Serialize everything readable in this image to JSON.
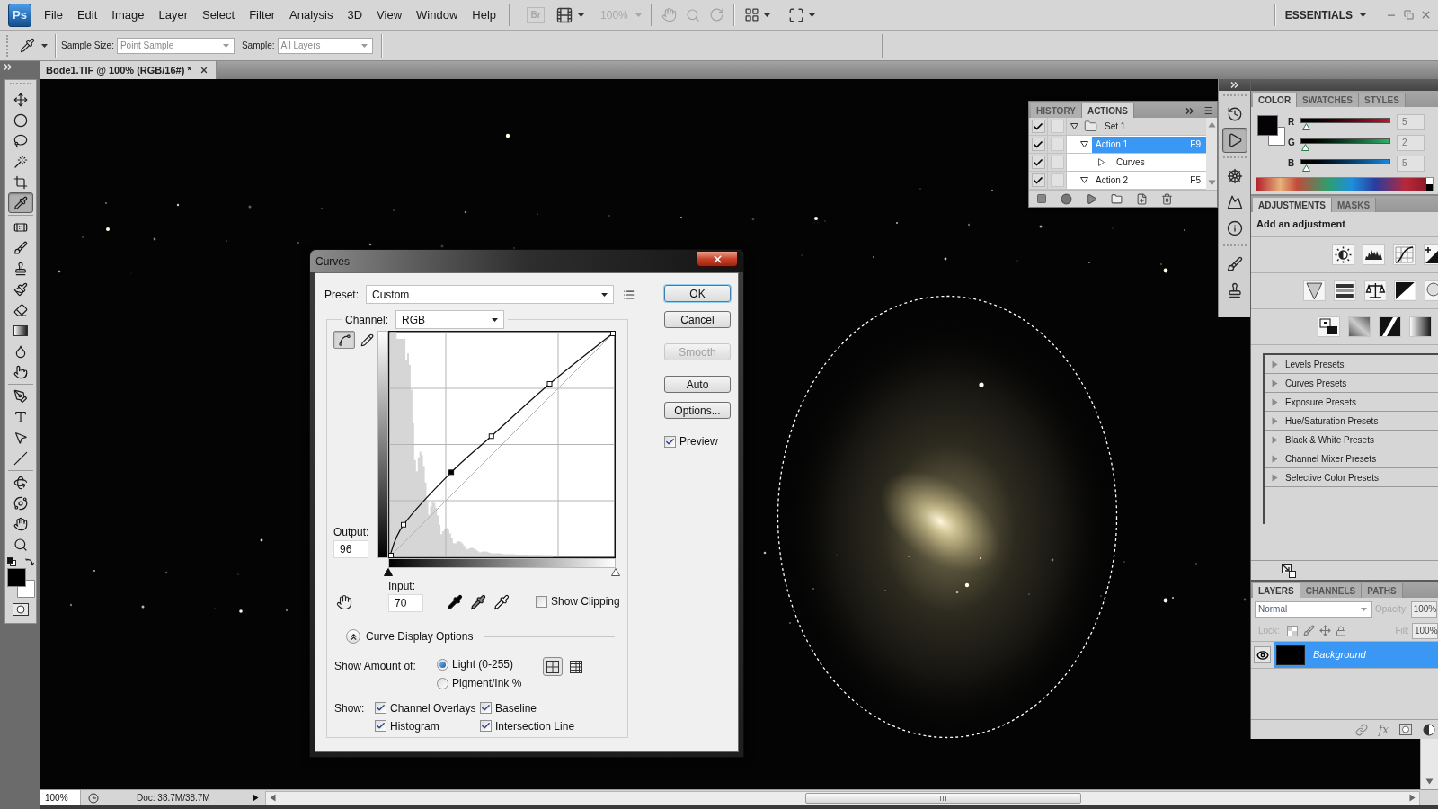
{
  "menu_bar": {
    "logo": "Ps",
    "items": [
      "File",
      "Edit",
      "Image",
      "Layer",
      "Select",
      "Filter",
      "Analysis",
      "3D",
      "View",
      "Window",
      "Help"
    ],
    "bridge": "Br",
    "zoom": {
      "value": "100%",
      "disabled": true
    },
    "workspace": "ESSENTIALS"
  },
  "options_bar": {
    "sample_size": {
      "label": "Sample Size:",
      "value": "Point Sample"
    },
    "sample": {
      "label": "Sample:",
      "value": "All Layers"
    }
  },
  "tools": [
    {
      "selected": false
    },
    {
      "selected": false
    },
    {
      "selected": false
    },
    {
      "selected": false
    },
    {
      "selected": false
    },
    {
      "selected": true
    },
    {
      "selected": false
    },
    {
      "selected": false
    },
    {
      "selected": false
    },
    {
      "selected": false
    },
    {
      "selected": false
    },
    {
      "selected": false
    },
    {
      "selected": false
    },
    {
      "selected": false
    },
    {
      "selected": false
    },
    {
      "selected": false
    },
    {
      "selected": false
    },
    {
      "selected": false
    },
    {
      "selected": false
    },
    {
      "selected": false
    },
    {
      "selected": false
    },
    {
      "selected": false
    }
  ],
  "document": {
    "tab": "Bode1.TIF @ 100% (RGB/16#) *",
    "status": {
      "zoom": "100%",
      "doc": "Doc: 38.7M/38.7M"
    }
  },
  "actions_panel": {
    "tabs": [
      {
        "label": "HISTORY",
        "selected": false
      },
      {
        "label": "ACTIONS",
        "selected": true
      }
    ],
    "items": [
      {
        "label": "Set 1",
        "kind": "set",
        "checked": true,
        "dialog": false,
        "expanded": true,
        "selected": false,
        "children": [
          {
            "label": "Action 1",
            "kind": "action",
            "shortcut": "F9",
            "checked": true,
            "dialog": false,
            "expanded": true,
            "selected": true,
            "children": [
              {
                "label": "Curves",
                "kind": "command",
                "checked": true,
                "dialog": false,
                "expanded": false,
                "selected": false
              }
            ]
          },
          {
            "label": "Action 2",
            "kind": "action",
            "shortcut": "F5",
            "checked": true,
            "dialog": false,
            "expanded": true,
            "selected": false
          }
        ]
      }
    ]
  },
  "dock": [
    {
      "selected": false
    },
    {
      "selected": true
    },
    {
      "selected": false
    },
    {
      "selected": false
    },
    {
      "selected": false
    },
    {
      "selected": false
    },
    {
      "selected": false
    }
  ],
  "color_panel": {
    "tabs": [
      {
        "label": "COLOR",
        "selected": true
      },
      {
        "label": "SWATCHES",
        "selected": false
      },
      {
        "label": "STYLES",
        "selected": false
      }
    ],
    "channels": [
      {
        "name": "R",
        "value": "5",
        "level": 0.02
      },
      {
        "name": "G",
        "value": "2",
        "level": 0.01
      },
      {
        "name": "B",
        "value": "5",
        "level": 0.02
      }
    ]
  },
  "adjustments_panel": {
    "tabs": [
      {
        "label": "ADJUSTMENTS",
        "selected": true
      },
      {
        "label": "MASKS",
        "selected": false
      }
    ],
    "heading": "Add an adjustment",
    "presets": [
      {
        "label": "Levels Presets",
        "expanded": false
      },
      {
        "label": "Curves Presets",
        "expanded": false
      },
      {
        "label": "Exposure Presets",
        "expanded": false
      },
      {
        "label": "Hue/Saturation Presets",
        "expanded": false
      },
      {
        "label": "Black & White Presets",
        "expanded": false
      },
      {
        "label": "Channel Mixer Presets",
        "expanded": false
      },
      {
        "label": "Selective Color Presets",
        "expanded": false
      }
    ]
  },
  "layers_panel": {
    "tabs": [
      {
        "label": "LAYERS",
        "selected": true
      },
      {
        "label": "CHANNELS",
        "selected": false
      },
      {
        "label": "PATHS",
        "selected": false
      }
    ],
    "blend_mode": "Normal",
    "opacity": {
      "label": "Opacity:",
      "value": "100%",
      "disabled": true
    },
    "lock_label": "Lock:",
    "fill": {
      "label": "Fill:",
      "value": "100%",
      "disabled": true
    },
    "layers": [
      {
        "name": "Background",
        "visible": true,
        "selected": true
      }
    ],
    "styles_button": "fx"
  },
  "curves_dialog": {
    "title": "Curves",
    "preset": {
      "label": "Preset:",
      "value": "Custom"
    },
    "buttons": [
      {
        "label": "OK",
        "focused": true,
        "disabled": false
      },
      {
        "label": "Cancel",
        "focused": false,
        "disabled": false
      },
      {
        "label": "Smooth",
        "focused": false,
        "disabled": true
      },
      {
        "label": "Auto",
        "focused": false,
        "disabled": false
      },
      {
        "label": "Options...",
        "focused": false,
        "disabled": false
      }
    ],
    "preview": {
      "label": "Preview",
      "checked": true
    },
    "channel": {
      "label": "Channel:",
      "value": "RGB"
    },
    "edit_modes": [
      {
        "selected": true
      },
      {
        "selected": false
      }
    ],
    "points": [
      {
        "selected": false
      },
      {
        "selected": false
      },
      {
        "selected": true
      },
      {
        "selected": false
      },
      {
        "selected": false
      },
      {
        "selected": false
      }
    ],
    "output": {
      "label": "Output:",
      "value": "96"
    },
    "input": {
      "label": "Input:",
      "value": "70"
    },
    "show_clipping": {
      "label": "Show Clipping",
      "checked": false
    },
    "display_options": {
      "label": "Curve Display Options",
      "expanded": true
    },
    "show_amount": {
      "label": "Show Amount of:",
      "options": [
        {
          "label": "Light (0-255)",
          "selected": true
        },
        {
          "label": "Pigment/Ink %",
          "selected": false
        }
      ]
    },
    "grid_sizes": [
      {
        "selected": true
      },
      {
        "selected": false
      }
    ],
    "show": {
      "label": "Show:",
      "options": [
        {
          "label": "Channel Overlays",
          "checked": true
        },
        {
          "label": "Baseline",
          "checked": true
        },
        {
          "label": "Histogram",
          "checked": true
        },
        {
          "label": "Intersection Line",
          "checked": true
        }
      ]
    }
  }
}
